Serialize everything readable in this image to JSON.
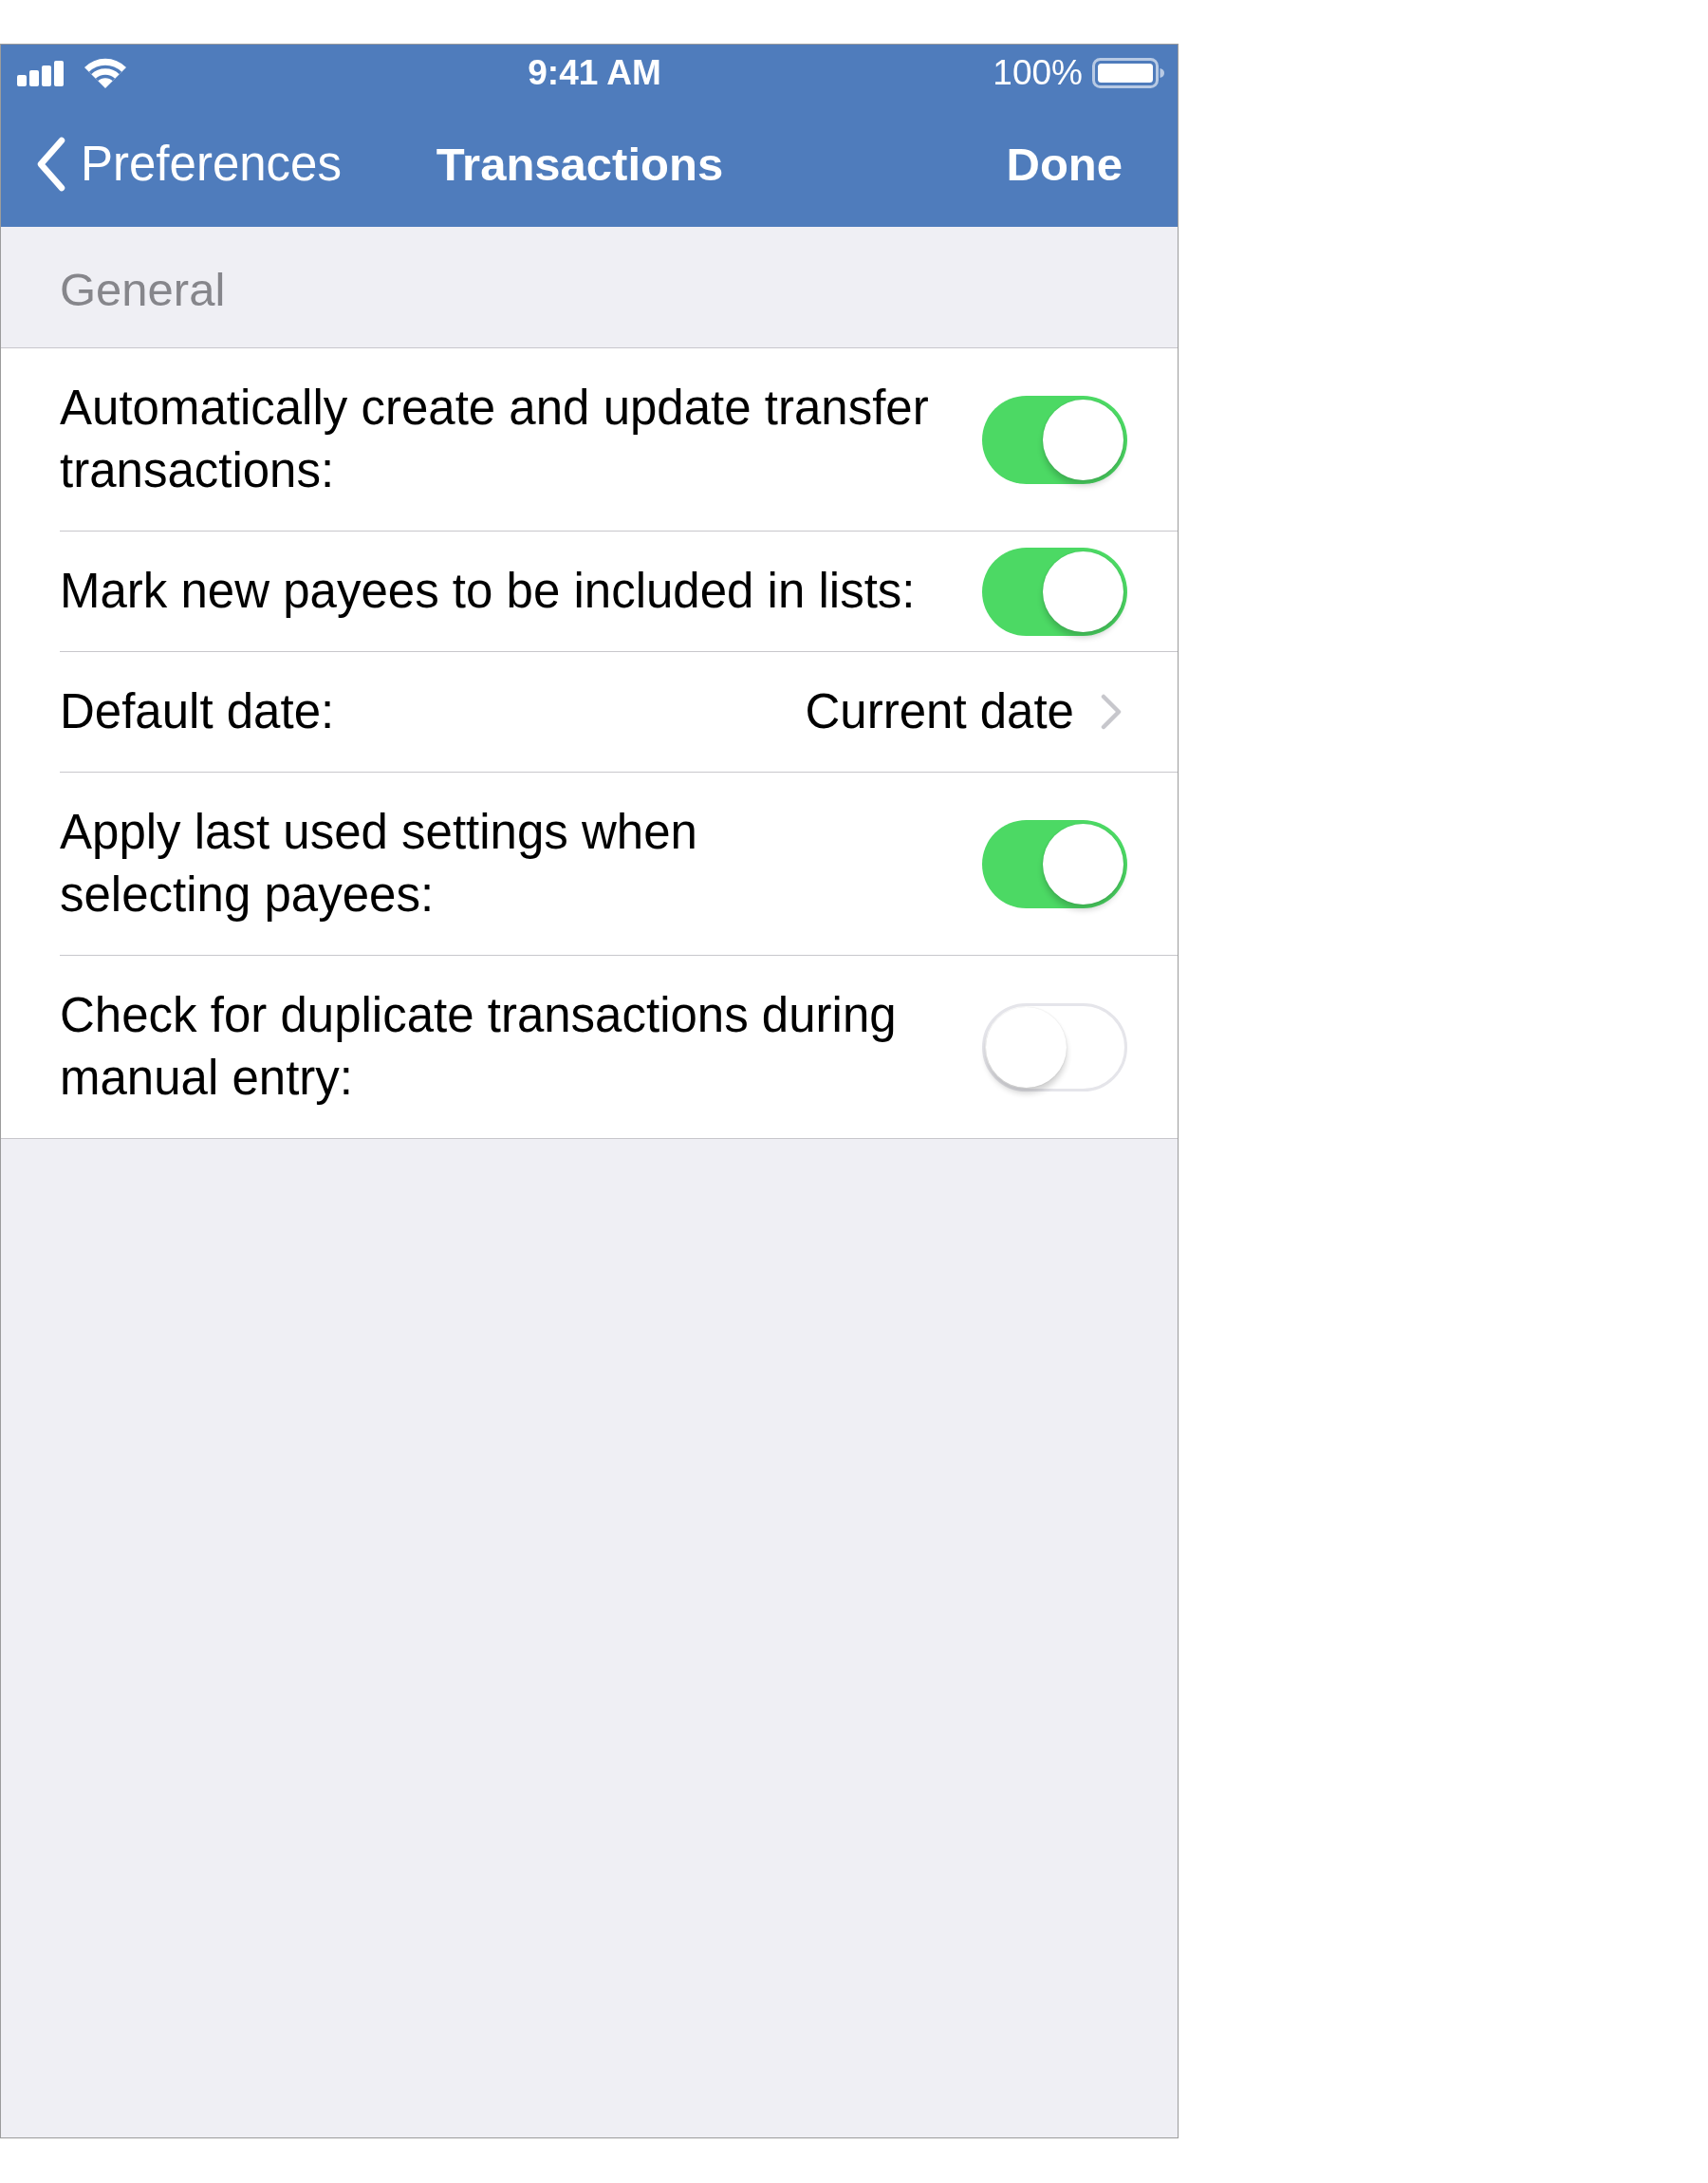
{
  "status_bar": {
    "time": "9:41 AM",
    "battery_text": "100%"
  },
  "nav_bar": {
    "back_label": "Preferences",
    "title": "Transactions",
    "action": "Done"
  },
  "sections": [
    {
      "header": "General",
      "rows": [
        {
          "kind": "toggle",
          "label": "Automatically create and update transfer\ntransactions:",
          "on": true
        },
        {
          "kind": "toggle",
          "label": "Mark new payees to be included in lists:",
          "on": true
        },
        {
          "kind": "disclosure",
          "label": "Default date:",
          "value": "Current date"
        },
        {
          "kind": "toggle",
          "label": "Apply last used settings when\nselecting payees:",
          "on": true
        },
        {
          "kind": "toggle",
          "label": "Check for duplicate transactions during\nmanual entry:",
          "on": false
        }
      ]
    }
  ]
}
